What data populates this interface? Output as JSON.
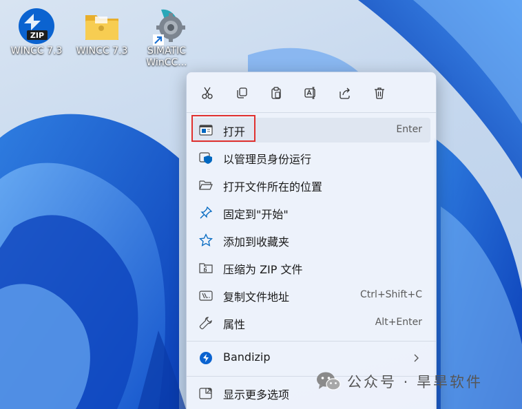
{
  "desktop": {
    "icons": [
      {
        "label": "WINCC 7.3",
        "icon": "zip-archive-icon"
      },
      {
        "label": "WINCC 7.3",
        "icon": "folder-icon"
      },
      {
        "label_line1": "SIMATIC",
        "label_line2": "WinCC...",
        "icon": "gear-shortcut-icon"
      }
    ]
  },
  "context_menu": {
    "quick_actions": [
      "cut-icon",
      "copy-icon",
      "paste-icon",
      "rename-icon",
      "share-icon",
      "delete-icon"
    ],
    "items": [
      {
        "label": "打开",
        "shortcut": "Enter",
        "icon": "open-window-icon"
      },
      {
        "label": "以管理员身份运行",
        "shortcut": "",
        "icon": "admin-shield-icon"
      },
      {
        "label": "打开文件所在的位置",
        "shortcut": "",
        "icon": "folder-open-icon"
      },
      {
        "label": "固定到\"开始\"",
        "shortcut": "",
        "icon": "pin-icon"
      },
      {
        "label": "添加到收藏夹",
        "shortcut": "",
        "icon": "star-icon"
      },
      {
        "label": "压缩为 ZIP 文件",
        "shortcut": "",
        "icon": "zip-folder-icon"
      },
      {
        "label": "复制文件地址",
        "shortcut": "Ctrl+Shift+C",
        "icon": "copy-path-icon"
      },
      {
        "label": "属性",
        "shortcut": "Alt+Enter",
        "icon": "wrench-icon"
      },
      {
        "label": "Bandizip",
        "shortcut": "",
        "icon": "bandizip-icon"
      },
      {
        "label": "显示更多选项",
        "shortcut": "",
        "icon": "more-options-icon"
      }
    ]
  },
  "watermark": {
    "text": "公众号 · 旱旱软件",
    "icon": "wechat-icon"
  },
  "colors": {
    "highlight_border": "#e0302e",
    "accent": "#0067c0"
  }
}
